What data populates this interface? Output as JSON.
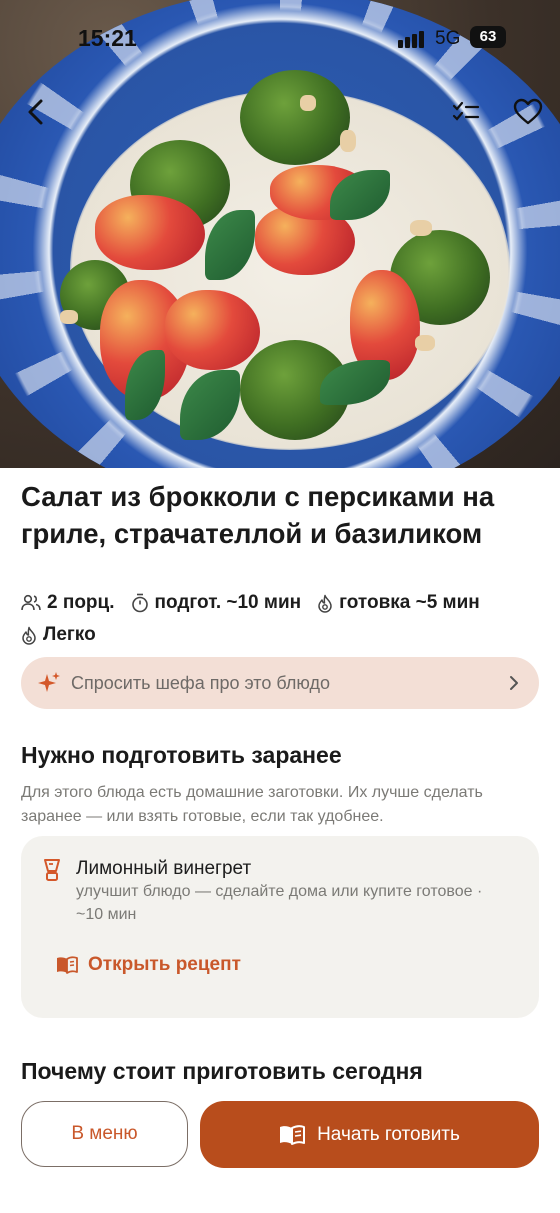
{
  "status_bar": {
    "time": "15:21",
    "network": "5G",
    "battery": "63"
  },
  "recipe": {
    "title": "Салат из брокколи с персиками на гриле, страчателлой и базиликом",
    "meta": {
      "servings": "2 порц.",
      "prep": "подгот. ~10 мин",
      "cook": "готовка ~5 мин",
      "difficulty": "Легко"
    }
  },
  "ask_chef": {
    "label": "Спросить шефа про это блюдо"
  },
  "prep_section": {
    "title": "Нужно подготовить заранее",
    "description": "Для этого блюда есть домашние заготовки. Их лучше сделать заранее — или взять готовые, если так удобнее.",
    "item": {
      "title": "Лимонный винегрет",
      "subtitle": "улучшит блюдо — сделайте дома или купите готовое · ~10 мин",
      "link_label": "Открыть рецепт"
    }
  },
  "why_section": {
    "title": "Почему стоит приготовить сегодня"
  },
  "actions": {
    "menu_label": "В меню",
    "start_label": "Начать готовить"
  },
  "colors": {
    "accent": "#c9582b",
    "primary_button": "#b84d1c",
    "ask_bg": "#f3dfd6",
    "card_bg": "#f3f2ee"
  }
}
